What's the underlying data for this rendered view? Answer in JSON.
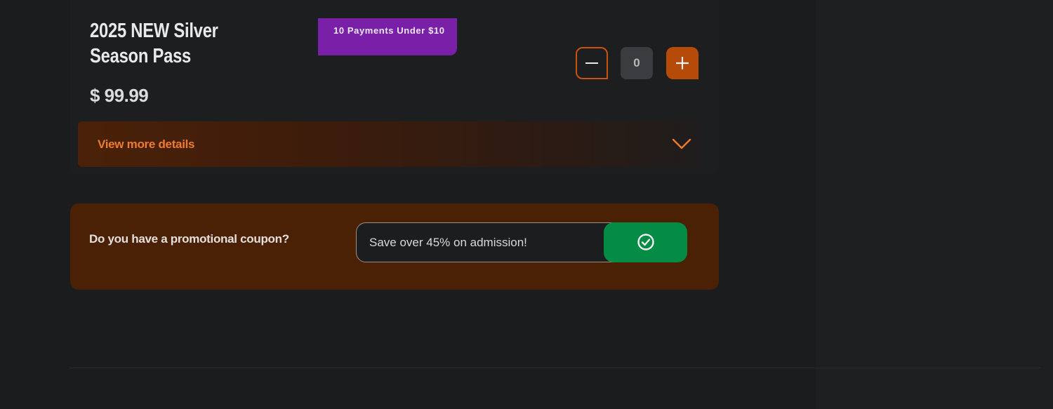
{
  "ticket": {
    "title": "2025 NEW Silver Season Pass",
    "promo_tag": "10 Payments Under $10",
    "price": "$ 99.99",
    "quantity": "0",
    "details_label": "View more details",
    "icons": {
      "decrement": "minus-icon",
      "increment": "plus-icon",
      "expand": "chevron-down-icon"
    }
  },
  "coupon": {
    "question": "Do you have a promotional coupon?",
    "placeholder": "Save over 45% on admission!",
    "apply_icon": "check-circle-icon"
  },
  "colors": {
    "background": "#1b1c1e",
    "accent_orange": "#b54a09",
    "promo_purple": "#7a1fa8",
    "coupon_bg": "#4a2105",
    "apply_green": "#048c44"
  }
}
